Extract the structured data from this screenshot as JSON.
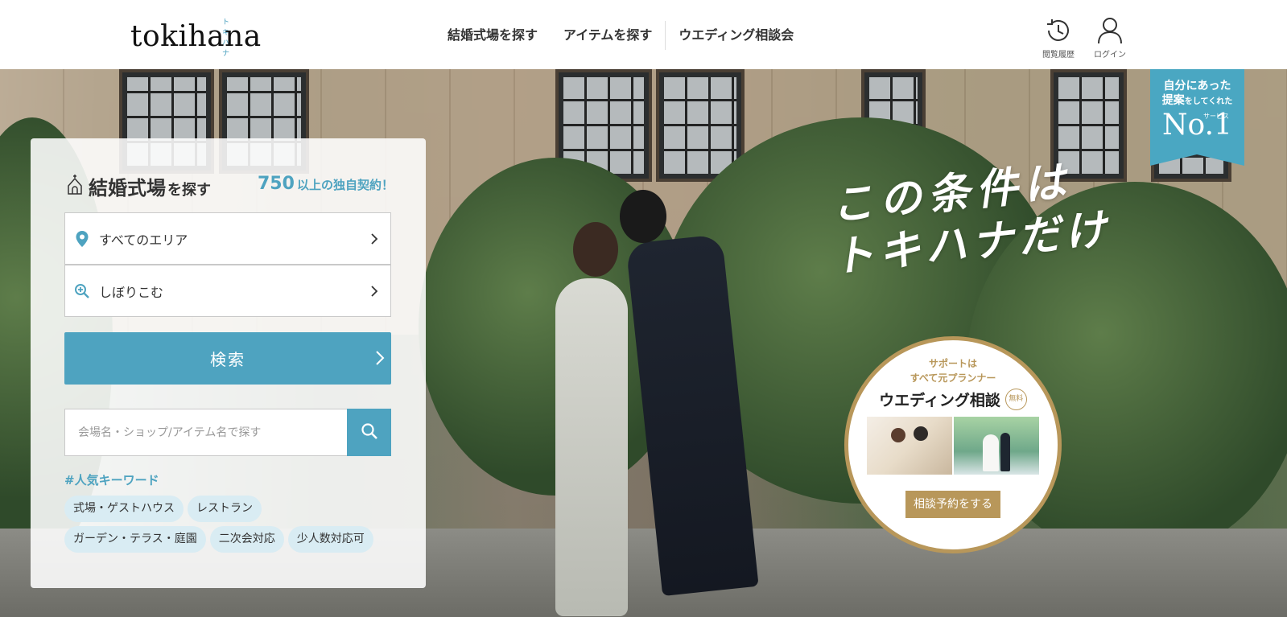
{
  "header": {
    "logo_text": "tokihana",
    "logo_ruby": "トキハナ",
    "nav": [
      {
        "label": "結婚式場を探す"
      },
      {
        "label": "アイテムを探す"
      },
      {
        "label": "ウエディング相談会"
      }
    ],
    "history_label": "閲覧履歴",
    "login_label": "ログイン"
  },
  "search_panel": {
    "title_main": "結婚式場",
    "title_suffix": "を探す",
    "count_num": "750",
    "count_text": "以上の独自契約！",
    "area_label": "すべてのエリア",
    "filter_label": "しぼりこむ",
    "search_button": "検索",
    "keyword_placeholder": "会場名・ショップ/アイテム名で探す",
    "popular_title": "#人気キーワード",
    "tags": [
      "式場・ゲストハウス",
      "レストラン",
      "ガーデン・テラス・庭園",
      "二次会対応",
      "少人数対応可"
    ]
  },
  "hero": {
    "catch_line1": "この条件は",
    "catch_line2": "トキハナだけ"
  },
  "badge": {
    "line1": "自分にあった",
    "line2_main": "提案",
    "line2_small": "をしてくれた",
    "sup": "サービス",
    "number": "No.1"
  },
  "consult": {
    "line1": "サポートは",
    "line2": "すべて元プランナー",
    "title": "ウエディング相談",
    "free": "無料",
    "button": "相談予約をする"
  },
  "colors": {
    "accent": "#4ea3c0",
    "gold": "#b8975a",
    "tag_bg": "#d9ecf3"
  }
}
